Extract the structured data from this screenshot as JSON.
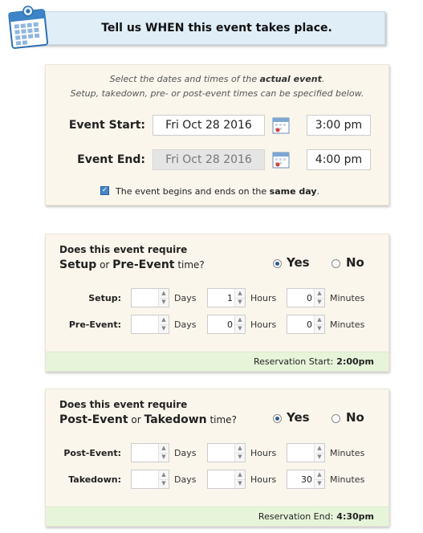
{
  "header": {
    "title": "Tell us WHEN this event takes place."
  },
  "dates": {
    "note_line1_pre": "Select the dates and times of the ",
    "note_line1_bold": "actual event",
    "note_line1_post": ".",
    "note_line2": "Setup, takedown, pre- or post-event times can be specified below.",
    "start_label": "Event Start:",
    "start_date": "Fri Oct 28 2016",
    "start_time": "3:00 pm",
    "end_label": "Event End:",
    "end_date": "Fri Oct 28 2016",
    "end_time": "4:00 pm",
    "same_day_pre": "The event begins and ends on the ",
    "same_day_bold": "same day",
    "same_day_post": ".",
    "same_day_checked": true
  },
  "setup": {
    "question_line1": "Does this event require",
    "question_bold_a": "Setup",
    "question_or": " or ",
    "question_bold_b": "Pre-Event",
    "question_tail": " time?",
    "yes_label": "Yes",
    "no_label": "No",
    "selected": "Yes",
    "rows": [
      {
        "label": "Setup:",
        "days": "",
        "hours": "1",
        "minutes": "0"
      },
      {
        "label": "Pre-Event:",
        "days": "",
        "hours": "0",
        "minutes": "0"
      }
    ],
    "units": {
      "days": "Days",
      "hours": "Hours",
      "minutes": "Minutes"
    },
    "footer_label": "Reservation Start:",
    "footer_value": "2:00pm"
  },
  "post": {
    "question_line1": "Does this event require",
    "question_bold_a": "Post-Event",
    "question_or": " or ",
    "question_bold_b": "Takedown",
    "question_tail": " time?",
    "yes_label": "Yes",
    "no_label": "No",
    "selected": "Yes",
    "rows": [
      {
        "label": "Post-Event:",
        "days": "",
        "hours": "",
        "minutes": ""
      },
      {
        "label": "Takedown:",
        "days": "",
        "hours": "",
        "minutes": "30"
      }
    ],
    "units": {
      "days": "Days",
      "hours": "Hours",
      "minutes": "Minutes"
    },
    "footer_label": "Reservation End:",
    "footer_value": "4:30pm"
  },
  "icons": {
    "header_icon": "calendar-icon",
    "date_picker_icon": "calendar-icon"
  },
  "colors": {
    "header_bg": "#dfeef7",
    "panel_bg": "#faf6ec",
    "footer_bg": "#e6f5da",
    "accent": "#2f5d8a"
  }
}
